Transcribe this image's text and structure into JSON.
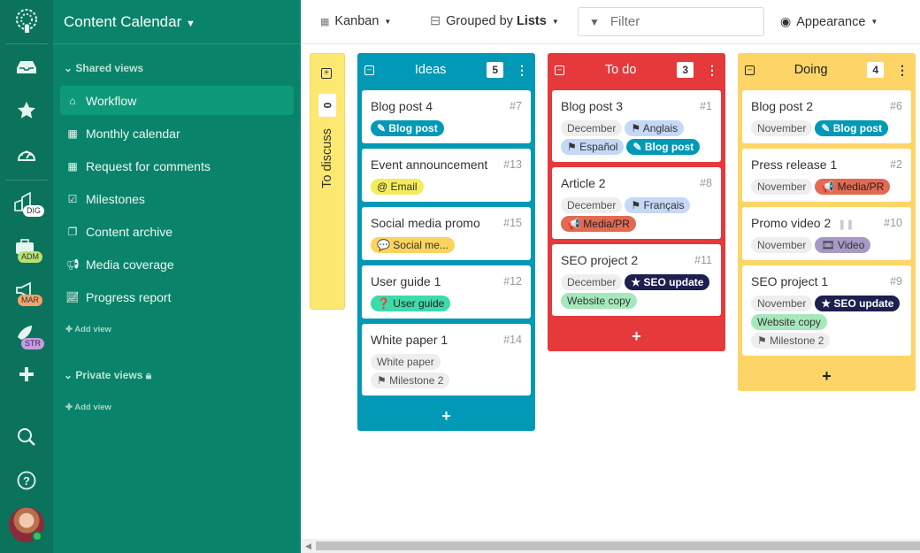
{
  "app": {
    "title": "Content Calendar"
  },
  "rail": {
    "workspaces": [
      {
        "code": "DIG",
        "color": "#ffffff"
      },
      {
        "code": "ADM",
        "color": "#b7e36e"
      },
      {
        "code": "MAR",
        "color": "#f6a36a"
      },
      {
        "code": "STR",
        "color": "#c79ae8"
      }
    ]
  },
  "nav": {
    "shared_label": "Shared views",
    "private_label": "Private views",
    "add_view": "Add view",
    "items": [
      {
        "label": "Workflow",
        "icon": "home-icon",
        "active": true
      },
      {
        "label": "Monthly calendar",
        "icon": "calendar-icon"
      },
      {
        "label": "Request for comments",
        "icon": "calendar-icon"
      },
      {
        "label": "Milestones",
        "icon": "calendar-check-icon"
      },
      {
        "label": "Content archive",
        "icon": "copy-icon"
      },
      {
        "label": "Media coverage",
        "icon": "megaphone-icon"
      },
      {
        "label": "Progress report",
        "icon": "chart-line-icon"
      }
    ]
  },
  "toolbar": {
    "view": "Kanban",
    "grouped_prefix": "Grouped by ",
    "grouped_by": "Lists",
    "filter_placeholder": "Filter",
    "appearance": "Appearance"
  },
  "board": {
    "collapsed": {
      "name": "To discuss",
      "count": "0"
    },
    "columns": [
      {
        "name": "Ideas",
        "count": "5",
        "color": "#0199b6",
        "cards": [
          {
            "title": "Blog post 4",
            "num": "#7",
            "tags": [
              {
                "text": "✎ Blog post",
                "type": "blog"
              }
            ]
          },
          {
            "title": "Event announcement",
            "num": "#13",
            "tags": [
              {
                "text": "@ Email",
                "type": "email"
              }
            ]
          },
          {
            "title": "Social media promo",
            "num": "#15",
            "tags": [
              {
                "text": "💬 Social me...",
                "type": "social"
              }
            ]
          },
          {
            "title": "User guide 1",
            "num": "#12",
            "tags": [
              {
                "text": "❓ User guide",
                "type": "guide"
              }
            ]
          },
          {
            "title": "White paper 1",
            "num": "#14",
            "tags": [
              {
                "text": "White paper",
                "type": "grey"
              },
              {
                "text": "⚑ Milestone 2",
                "type": "grey"
              }
            ]
          }
        ]
      },
      {
        "name": "To do",
        "count": "3",
        "color": "#e5393c",
        "cards": [
          {
            "title": "Blog post 3",
            "num": "#1",
            "tags": [
              {
                "text": "December",
                "type": "grey"
              },
              {
                "text": "⚑ Anglais",
                "type": "lang"
              },
              {
                "text": "⚑ Español",
                "type": "lang"
              },
              {
                "text": "✎ Blog post",
                "type": "blog"
              }
            ]
          },
          {
            "title": "Article 2",
            "num": "#8",
            "tags": [
              {
                "text": "December",
                "type": "grey"
              },
              {
                "text": "⚑ Français",
                "type": "lang"
              },
              {
                "text": "📢 Media/PR",
                "type": "media"
              }
            ]
          },
          {
            "title": "SEO project 2",
            "num": "#11",
            "tags": [
              {
                "text": "December",
                "type": "grey"
              },
              {
                "text": "★ SEO update",
                "type": "seo"
              },
              {
                "text": "Website copy",
                "type": "web"
              }
            ]
          }
        ]
      },
      {
        "name": "Doing",
        "count": "4",
        "color": "#fdd567",
        "cards": [
          {
            "title": "Blog post 2",
            "num": "#6",
            "tags": [
              {
                "text": "November",
                "type": "grey"
              },
              {
                "text": "✎ Blog post",
                "type": "blog"
              }
            ]
          },
          {
            "title": "Press release 1",
            "num": "#2",
            "tags": [
              {
                "text": "November",
                "type": "grey"
              },
              {
                "text": "📢 Media/PR",
                "type": "media"
              }
            ]
          },
          {
            "title": "Promo video 2",
            "num": "#10",
            "paused": true,
            "tags": [
              {
                "text": "November",
                "type": "grey"
              },
              {
                "text": "🎞 Video",
                "type": "video"
              }
            ]
          },
          {
            "title": "SEO project 1",
            "num": "#9",
            "tags": [
              {
                "text": "November",
                "type": "grey"
              },
              {
                "text": "★ SEO update",
                "type": "seo"
              },
              {
                "text": "Website copy",
                "type": "web"
              },
              {
                "text": "⚑ Milestone 2",
                "type": "grey"
              }
            ]
          }
        ]
      }
    ]
  },
  "tag_styles": {
    "grey": {
      "bg": "#eeeeee",
      "fg": "#555555"
    },
    "blog": {
      "bg": "#0199b6",
      "fg": "#ffffff"
    },
    "email": {
      "bg": "#f4ec5a",
      "fg": "#333333"
    },
    "social": {
      "bg": "#fcd35f",
      "fg": "#333333"
    },
    "guide": {
      "bg": "#3ddba9",
      "fg": "#222222"
    },
    "lang": {
      "bg": "#c5d8f6",
      "fg": "#333333"
    },
    "media": {
      "bg": "#e36a52",
      "fg": "#222222"
    },
    "seo": {
      "bg": "#1c1f4f",
      "fg": "#ffffff"
    },
    "web": {
      "bg": "#a6e8bc",
      "fg": "#333333"
    },
    "video": {
      "bg": "#a998c4",
      "fg": "#333333"
    }
  }
}
